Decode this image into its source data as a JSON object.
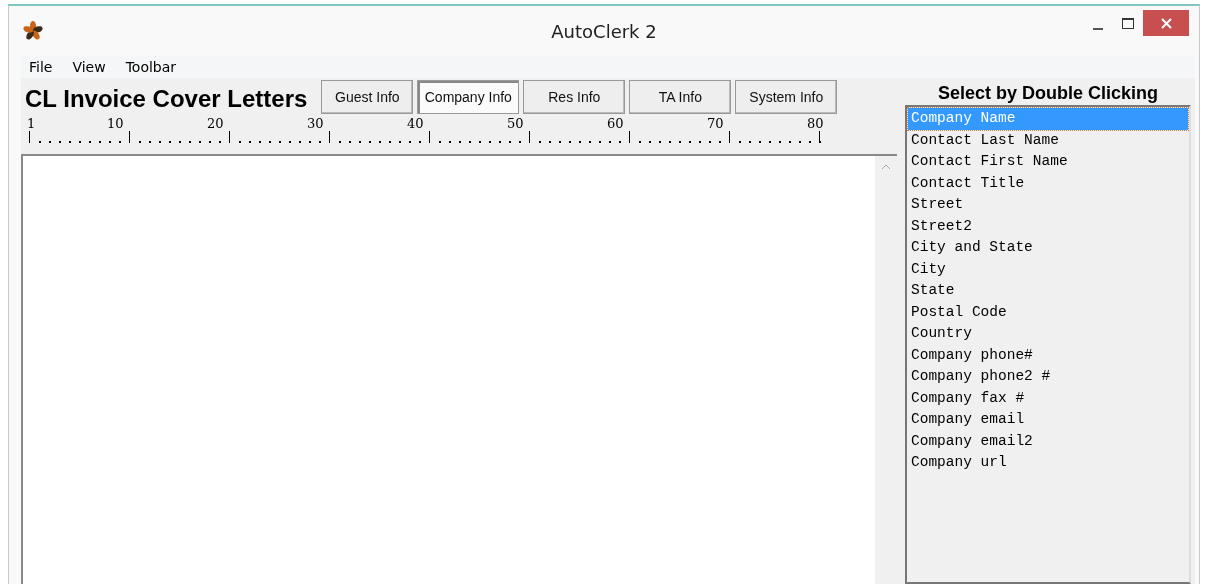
{
  "window": {
    "title": "AutoClerk 2"
  },
  "menu": [
    "File",
    "View",
    "Toolbar"
  ],
  "heading": "CL Invoice Cover Letters",
  "tabs": [
    {
      "label": "Guest Info",
      "selected": false
    },
    {
      "label": "Company Info",
      "selected": true
    },
    {
      "label": "Res Info",
      "selected": false
    },
    {
      "label": "TA Info",
      "selected": false
    },
    {
      "label": "System Info",
      "selected": false
    }
  ],
  "ruler": [
    "1",
    "10",
    "20",
    "30",
    "40",
    "50",
    "60",
    "70",
    "80"
  ],
  "field_list": {
    "title": "Select by Double Clicking",
    "items": [
      {
        "label": "Company Name",
        "selected": true
      },
      {
        "label": "Contact Last Name",
        "selected": false
      },
      {
        "label": "Contact First Name",
        "selected": false
      },
      {
        "label": "Contact Title",
        "selected": false
      },
      {
        "label": "Street",
        "selected": false
      },
      {
        "label": "Street2",
        "selected": false
      },
      {
        "label": "City and State",
        "selected": false
      },
      {
        "label": "City",
        "selected": false
      },
      {
        "label": "State",
        "selected": false
      },
      {
        "label": "Postal Code",
        "selected": false
      },
      {
        "label": "Country",
        "selected": false
      },
      {
        "label": "Company phone#",
        "selected": false
      },
      {
        "label": "Company phone2 #",
        "selected": false
      },
      {
        "label": "Company fax #",
        "selected": false
      },
      {
        "label": "Company email",
        "selected": false
      },
      {
        "label": "Company email2",
        "selected": false
      },
      {
        "label": "Company url",
        "selected": false
      }
    ]
  }
}
